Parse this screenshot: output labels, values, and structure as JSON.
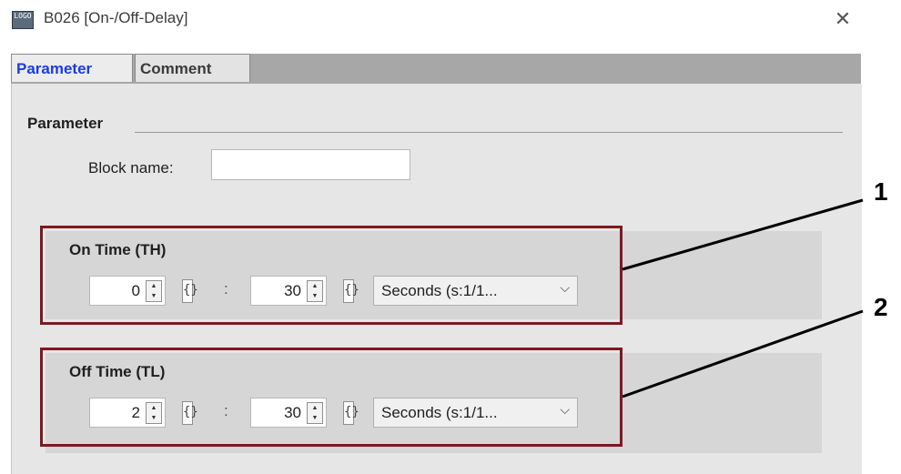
{
  "window": {
    "title": "B026 [On-/Off-Delay]",
    "app_icon_text": "LOGO"
  },
  "tabs": [
    {
      "label": "Parameter",
      "active": true
    },
    {
      "label": "Comment",
      "active": false
    }
  ],
  "parameter": {
    "group_label": "Parameter",
    "block_name_label": "Block name:",
    "block_name_value": ""
  },
  "on_time": {
    "title": "On Time (TH)",
    "value1": "0",
    "value2": "30",
    "separator": ":",
    "unit": "Seconds (s:1/1..."
  },
  "off_time": {
    "title": "Off Time (TL)",
    "value1": "2",
    "value2": "30",
    "separator": ":",
    "unit": "Seconds (s:1/1..."
  },
  "callouts": [
    "1",
    "2"
  ],
  "icons": {
    "close": "close-icon",
    "spinner": "spinner-arrows-icon",
    "parameter_link": "brace-icon",
    "dropdown": "chevron-down-icon"
  },
  "colors": {
    "active_tab_text": "#1a3be6",
    "highlight_frame": "#7e1820"
  }
}
